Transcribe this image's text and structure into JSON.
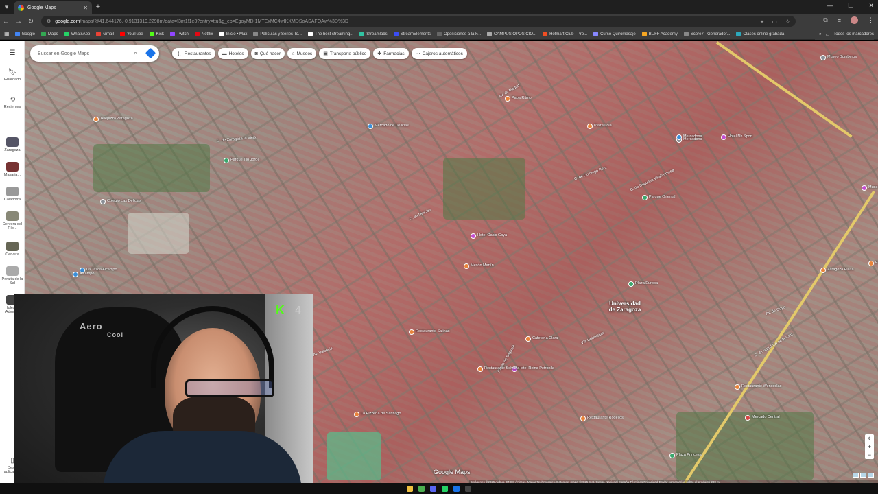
{
  "browser": {
    "tab_title": "Google Maps",
    "new_tab": "+",
    "url_host": "google.com",
    "url_path": "/maps/@41.644176,-0.9131319,2298m/data=!3m1!1e3?entry=ttu&g_ep=EgoyMDI1MTExMC4wIKXMDSoASAFQAw%3D%3D",
    "bookmarks": [
      {
        "label": "Google",
        "color": "#4285f4"
      },
      {
        "label": "Maps",
        "color": "#34a853"
      },
      {
        "label": "WhatsApp",
        "color": "#25d366"
      },
      {
        "label": "Gmail",
        "color": "#ea4335"
      },
      {
        "label": "YouTube",
        "color": "#ff0000"
      },
      {
        "label": "Kick",
        "color": "#53fc18"
      },
      {
        "label": "Twitch",
        "color": "#9146ff"
      },
      {
        "label": "Netflix",
        "color": "#e50914"
      },
      {
        "label": "Inicio • Max",
        "color": "#ffffff"
      },
      {
        "label": "Películas y Series To...",
        "color": "#888888"
      },
      {
        "label": "The best streaming...",
        "color": "#ffffff"
      },
      {
        "label": "Streamlabs",
        "color": "#31c3a2"
      },
      {
        "label": "StreamElements",
        "color": "#3b4df5"
      },
      {
        "label": "Oposiciones a la F...",
        "color": "#666666"
      },
      {
        "label": "CAMPUS OPOSICIO...",
        "color": "#aaaaaa"
      },
      {
        "label": "Hotmart Club - Pro...",
        "color": "#f04e23"
      },
      {
        "label": "Curso Quiromasaje",
        "color": "#8888ff"
      },
      {
        "label": "BUFF Academy",
        "color": "#f5a623"
      },
      {
        "label": "Score7 - Generador...",
        "color": "#888888"
      },
      {
        "label": "Clases online grabada",
        "color": "#2ca9bc"
      }
    ],
    "all_bookmarks": "Todos los marcadores"
  },
  "maps": {
    "search_placeholder": "Buscar en Google Maps",
    "chips": [
      {
        "label": "Restaurantes",
        "icon": "fork-knife-icon"
      },
      {
        "label": "Hoteles",
        "icon": "bed-icon"
      },
      {
        "label": "Qué hacer",
        "icon": "camera-icon"
      },
      {
        "label": "Museos",
        "icon": "museum-icon"
      },
      {
        "label": "Transporte público",
        "icon": "train-icon"
      },
      {
        "label": "Farmacias",
        "icon": "pharmacy-icon"
      },
      {
        "label": "Cajeros automáticos",
        "icon": "atm-icon"
      }
    ],
    "rail": {
      "saved": "Guardado",
      "recent": "Recientes",
      "recent_places": [
        "Zaragoza",
        "Masaria...",
        "Calahorra",
        "Cervera del Río...",
        "Cervera",
        "Peralta de la Sal",
        "Iglesia Adven..."
      ],
      "desktop_app": "Desc. aplicación"
    },
    "university_label": "Universidad de Zaragoza",
    "watermark": "Google Maps",
    "attribution": "Imágenes ©2025 Airbus, CNES / Airbus, Maxar Technologies, Datos del mapa ©2025 Inst. Geogr. Nacional   España   Términos   Privacidad   Enviar comentarios sobre el producto   200 m",
    "places": [
      {
        "label": "Hotel Nh Sport",
        "kind": "p"
      },
      {
        "label": "Mercadona",
        "kind": "gr"
      },
      {
        "label": "Museo Bomberos",
        "kind": "gr"
      },
      {
        "label": "Plaza Europa",
        "kind": "g"
      },
      {
        "label": "Parque Oriental",
        "kind": "g"
      },
      {
        "label": "Mercadona",
        "kind": "b"
      },
      {
        "label": "Plaza Lola",
        "kind": "o"
      },
      {
        "label": "Papa Ritmo",
        "kind": "o"
      },
      {
        "label": "Mesón Martín",
        "kind": "o"
      },
      {
        "label": "Restaurante Rogelios",
        "kind": "o"
      },
      {
        "label": "Restaurante Wenceslao",
        "kind": "o"
      },
      {
        "label": "Hotel Reina Petronila",
        "kind": "p"
      },
      {
        "label": "Plaza Princesa",
        "kind": "g"
      },
      {
        "label": "Mercado Central",
        "kind": "r"
      },
      {
        "label": "La Tasca Alcampo",
        "kind": "b"
      },
      {
        "label": "Alcampo",
        "kind": "b"
      },
      {
        "label": "Museo de las Ciencias Naturales",
        "kind": "p"
      },
      {
        "label": "Zaragoza Plaza",
        "kind": "o"
      },
      {
        "label": "El Corte Inglés",
        "kind": "o"
      },
      {
        "label": "Restaurante Selvaña",
        "kind": "o"
      },
      {
        "label": "Cafetería Clara",
        "kind": "o"
      },
      {
        "label": "Telepizza Zaragoza",
        "kind": "o"
      },
      {
        "label": "Hotel Oasis Goya",
        "kind": "p"
      },
      {
        "label": "Parque Tío Jorge",
        "kind": "g"
      },
      {
        "label": "Colegio Las Delicias",
        "kind": "gr"
      },
      {
        "label": "La Pizzería de Santiago",
        "kind": "o"
      },
      {
        "label": "Restaurante Salinas",
        "kind": "o"
      },
      {
        "label": "Mercado de Delicias",
        "kind": "b"
      }
    ],
    "streets": [
      "Av. de Madrid",
      "C. de Delicias",
      "Vía Universitas",
      "C. de San Juan de la Cruz",
      "Paseo de Sagasta",
      "C. de Zaragoza la Vieja",
      "Av. de Goya",
      "C. de Duquesa Villahermosa",
      "Av. Valencia",
      "C. de Domingo Ram"
    ]
  },
  "webcam": {
    "chair_brand": "Aero",
    "chair_brand2": "Cool",
    "kick_badge": "K",
    "kick_count": "4"
  }
}
